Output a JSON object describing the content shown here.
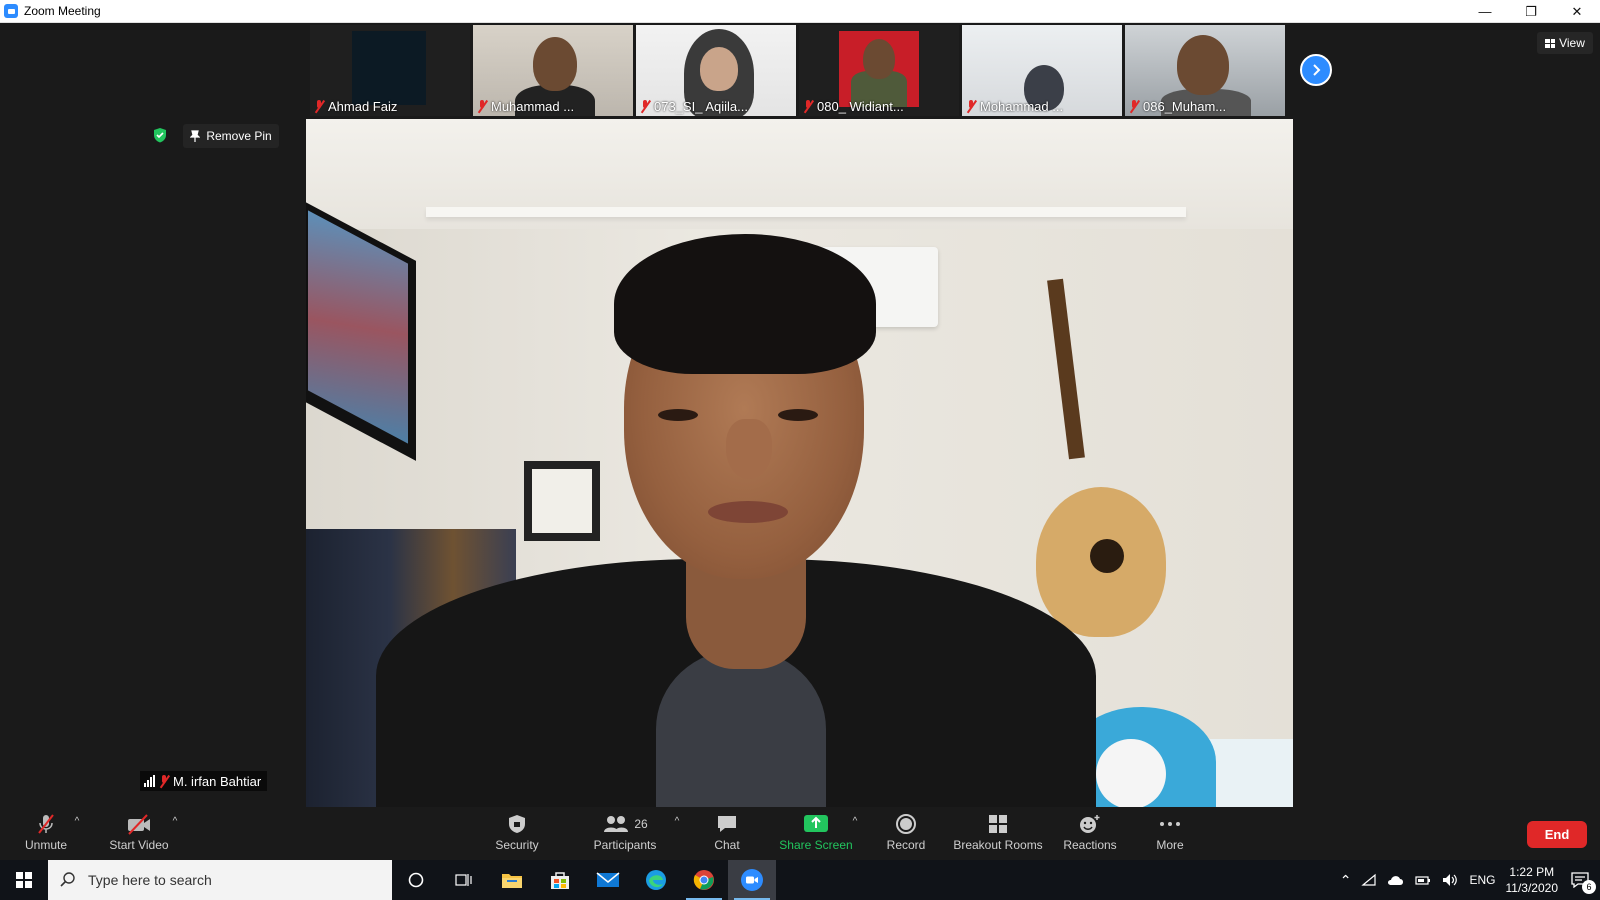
{
  "window": {
    "title": "Zoom Meeting",
    "controls": {
      "minimize": "—",
      "restore": "❐",
      "close": "✕"
    }
  },
  "thumbnails": [
    {
      "name": "Ahmad Faiz",
      "muted": true
    },
    {
      "name": "Muhammad ...",
      "muted": true
    },
    {
      "name": "073_SI_ Aqiila...",
      "muted": true
    },
    {
      "name": "080_ Widiant...",
      "muted": true
    },
    {
      "name": "Mohammad ...",
      "muted": true
    },
    {
      "name": "086_Muham...",
      "muted": true
    }
  ],
  "view_button": {
    "label": "View"
  },
  "pin": {
    "remove_label": "Remove Pin"
  },
  "main_video": {
    "speaker_name": "M. irfan Bahtiar",
    "muted": true
  },
  "toolbar": {
    "unmute": "Unmute",
    "start_video": "Start Video",
    "security": "Security",
    "participants": "Participants",
    "participants_count": "26",
    "chat": "Chat",
    "share_screen": "Share Screen",
    "record": "Record",
    "breakout_rooms": "Breakout Rooms",
    "reactions": "Reactions",
    "more": "More",
    "end": "End"
  },
  "taskbar": {
    "search_placeholder": "Type here to search",
    "language": "ENG",
    "time": "1:22 PM",
    "date": "11/3/2020",
    "notification_count": "6"
  },
  "colors": {
    "accent_blue": "#2d8cff",
    "end_red": "#e02828",
    "share_green": "#22c55e",
    "muted_red": "#e02828"
  }
}
